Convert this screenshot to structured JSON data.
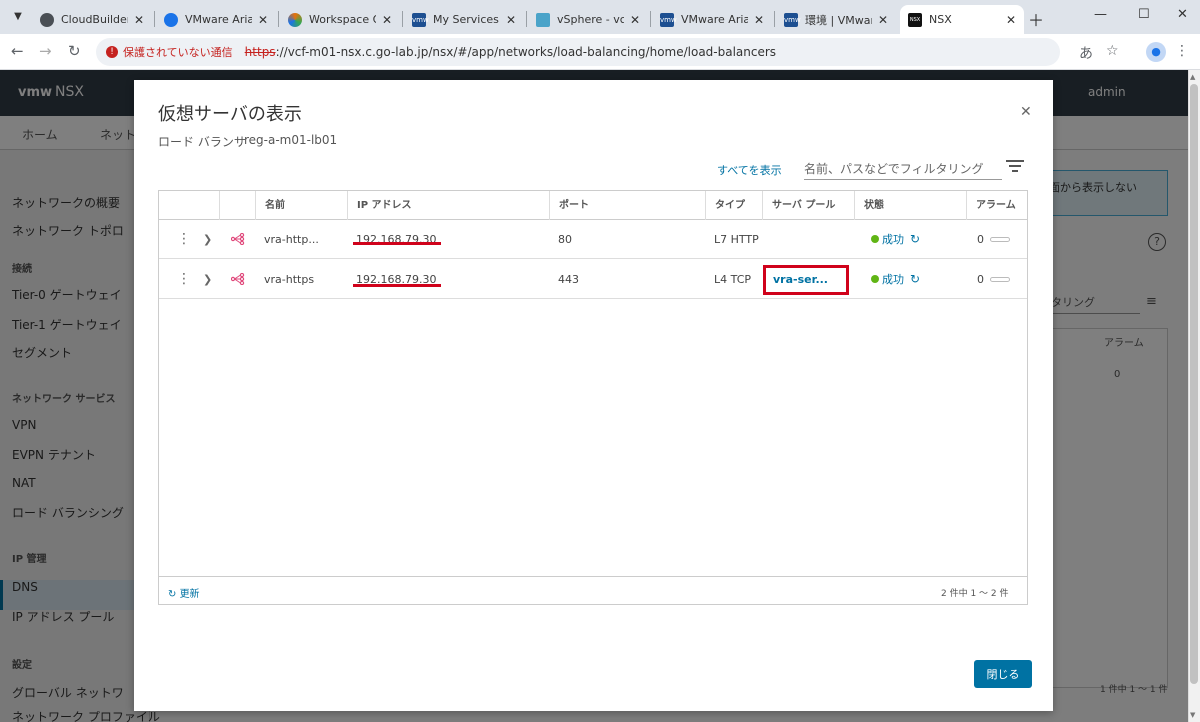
{
  "browser": {
    "tabs": [
      {
        "title": "CloudBuilder",
        "fav_color": "#4a4f55",
        "fav_glyph": ""
      },
      {
        "title": "VMware Aria Su",
        "fav_color": "#1a73e8",
        "fav_glyph": ""
      },
      {
        "title": "Workspace ONE",
        "fav_color": "#e8710a",
        "fav_glyph": ""
      },
      {
        "title": "My Services - Cl",
        "fav_color": "#1d4f91",
        "fav_glyph": "vmw"
      },
      {
        "title": "vSphere - vcf-m",
        "fav_color": "#4aa3c9",
        "fav_glyph": ""
      },
      {
        "title": "VMware Aria Su",
        "fav_color": "#1d4f91",
        "fav_glyph": "vmw"
      },
      {
        "title": "環境 | VMware A",
        "fav_color": "#1d4f91",
        "fav_glyph": "vmw"
      },
      {
        "title": "NSX",
        "fav_color": "#111111",
        "fav_glyph": "NSX"
      }
    ],
    "address": {
      "warning": "保護されていない通信",
      "url_scheme": "https",
      "url_rest": "://vcf-m01-nsx.c.go-lab.jp/nsx/#/app/networks/load-balancing/home/load-balancers"
    }
  },
  "nsx": {
    "logo": "vmw",
    "product": "NSX",
    "user": "admin",
    "nav": [
      "ホーム",
      "ネット"
    ],
    "sidebar": {
      "items_top": [
        "ネットワークの概要",
        "ネットワーク トポロ"
      ],
      "head_conn": "接続",
      "items_conn": [
        "Tier-0 ゲートウェイ",
        "Tier-1 ゲートウェイ",
        "セグメント"
      ],
      "head_services": "ネットワーク サービス",
      "items_services": [
        "VPN",
        "EVPN テナント",
        "NAT",
        "ロード バランシング"
      ],
      "head_ip": "IP 管理",
      "items_ip": [
        "DNS",
        "IP アドレス プール"
      ],
      "head_settings": "設定",
      "items_settings": [
        "グローバル ネットワ",
        "ネットワーク プロファイル"
      ]
    },
    "banner": "面から表示しない",
    "bg_filter": "ルタリング",
    "bg_alarm_header": "アラーム",
    "bg_alarm_value": "0",
    "bg_count": "1 件中 1 ～ 1 件"
  },
  "modal": {
    "title": "仮想サーバの表示",
    "lb_label": "ロード バランサ",
    "lb_value": "reg-a-m01-lb01",
    "show_all": "すべてを表示",
    "filter_placeholder": "名前、パスなどでフィルタリング",
    "columns": [
      "名前",
      "IP アドレス",
      "ポート",
      "タイプ",
      "サーバ プール",
      "状態",
      "アラーム"
    ],
    "rows": [
      {
        "name": "vra-http...",
        "ip": "192.168.79.30",
        "port": "80",
        "type": "L7 HTTP",
        "pool": "",
        "status": "成功",
        "alarms": "0"
      },
      {
        "name": "vra-https",
        "ip": "192.168.79.30",
        "port": "443",
        "type": "L4 TCP",
        "pool": "vra-ser...",
        "status": "成功",
        "alarms": "0"
      }
    ],
    "refresh": "更新",
    "count": "2 件中 1 ～ 2 件",
    "close": "閉じる"
  },
  "colors": {
    "accent": "#0072a3",
    "success": "#60b515",
    "highlight": "#d0021b"
  }
}
